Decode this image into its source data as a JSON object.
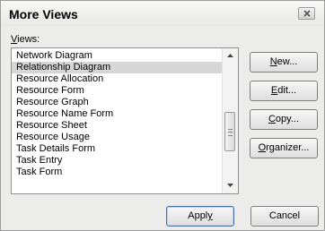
{
  "window": {
    "title": "More Views"
  },
  "views_label": {
    "mnemonic": "V",
    "rest": "iews:"
  },
  "views_list": {
    "items": [
      "Network Diagram",
      "Relationship Diagram",
      "Resource Allocation",
      "Resource Form",
      "Resource Graph",
      "Resource Name Form",
      "Resource Sheet",
      "Resource Usage",
      "Task Details Form",
      "Task Entry",
      "Task Form"
    ],
    "selected": "Relationship Diagram"
  },
  "buttons": {
    "new": {
      "mnemonic": "N",
      "rest": "ew..."
    },
    "edit": {
      "mnemonic": "E",
      "rest": "dit..."
    },
    "copy": {
      "mnemonic": "C",
      "rest": "opy..."
    },
    "organizer": {
      "mnemonic": "O",
      "rest": "rganizer..."
    },
    "apply": {
      "pre": "Appl",
      "mnemonic": "y"
    },
    "cancel": {
      "label": "Cancel"
    }
  },
  "icons": {
    "close": "close-icon",
    "scroll_up": "scroll-up-arrow-icon",
    "scroll_down": "scroll-down-arrow-icon"
  }
}
